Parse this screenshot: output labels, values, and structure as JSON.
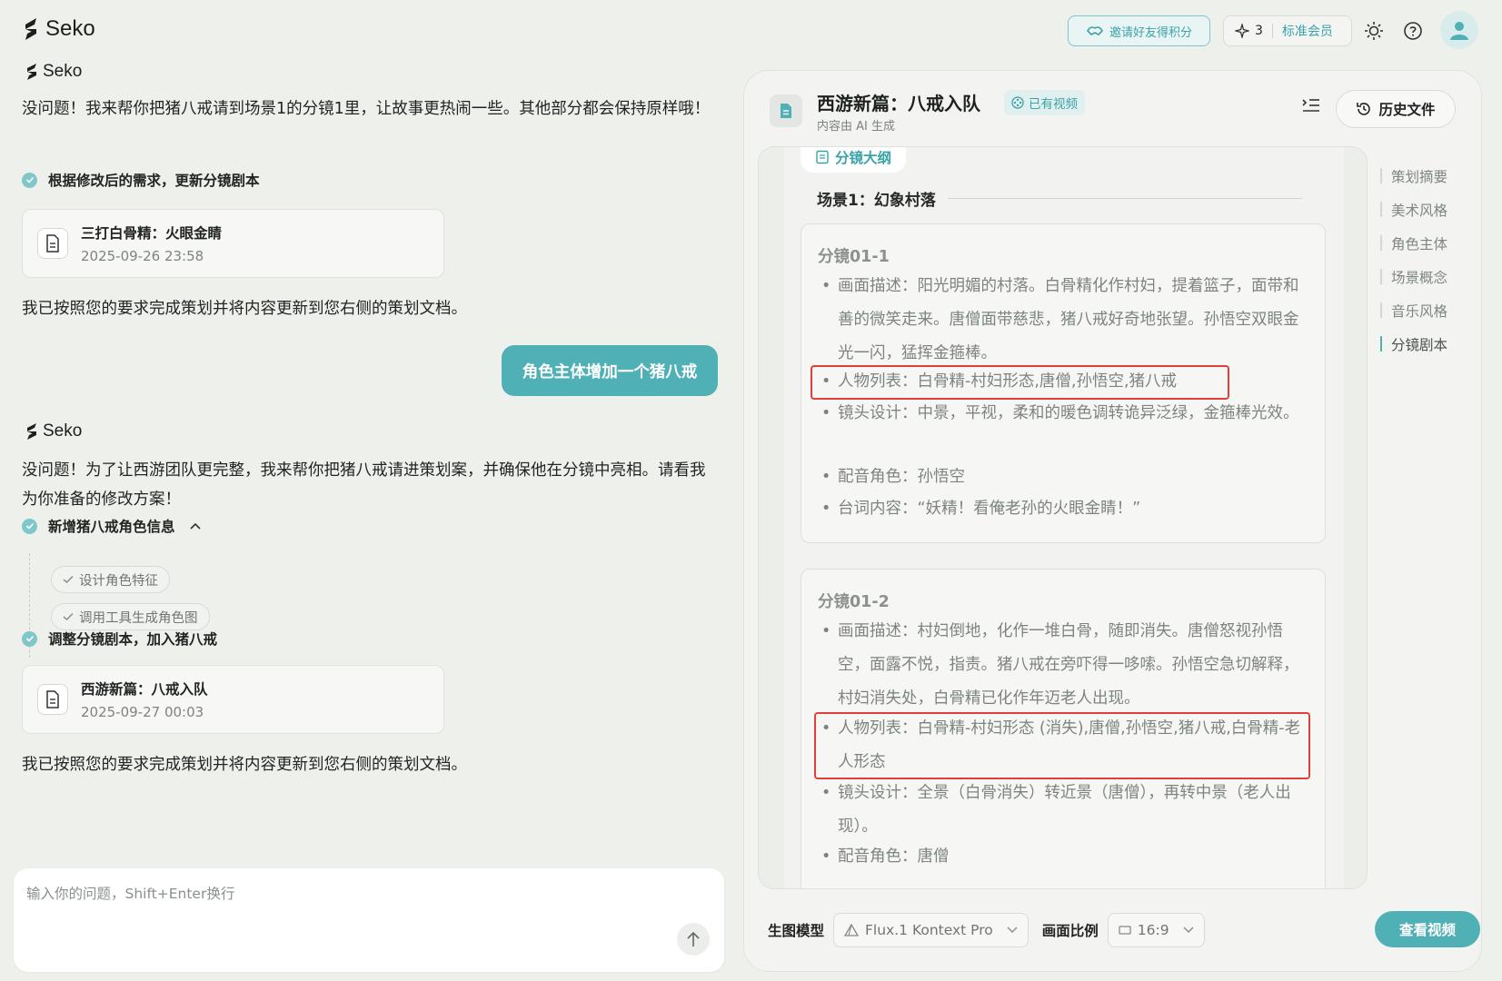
{
  "app": {
    "name": "Seko"
  },
  "topbar": {
    "invite_label": "邀请好友得积分",
    "credits": "3",
    "tier": "标准会员",
    "accent_color": "#4fb0b5"
  },
  "chat": {
    "msg1": {
      "speaker": "Seko",
      "text": "没问题！我来帮你把猪八戒请到场景1的分镜1里，让故事更热闹一些。其他部分都会保持原样哦！",
      "step": "根据修改后的需求，更新分镜剧本",
      "file": {
        "title": "三打白骨精：火眼金睛",
        "date": "2025-09-26 23:58"
      },
      "done": "我已按照您的要求完成策划并将内容更新到您右侧的策划文档。"
    },
    "user_msg": "角色主体增加一个猪八戒",
    "msg2": {
      "speaker": "Seko",
      "text": "没问题！为了让西游团队更完整，我来帮你把猪八戒请进策划案，并确保他在分镜中亮相。请看我为你准备的修改方案！",
      "step1": "新增猪八戒角色信息",
      "substeps": [
        "设计角色特征",
        "调用工具生成角色图"
      ],
      "step2": "调整分镜剧本，加入猪八戒",
      "file": {
        "title": "西游新篇：八戒入队",
        "date": "2025-09-27 00:03"
      },
      "done": "我已按照您的要求完成策划并将内容更新到您右侧的策划文档。"
    },
    "input_placeholder": "输入你的问题，Shift+Enter换行"
  },
  "doc": {
    "title": "西游新篇：八戒入队",
    "badge": "已有视频",
    "subtitle": "内容由 AI 生成",
    "history_label": "历史文件",
    "outline_tag": "分镜大纲",
    "scene_title": "场景1：幻象村落",
    "shots": [
      {
        "id": "分镜01-1",
        "desc": "画面描述：阳光明媚的村落。白骨精化作村妇，提着篮子，面带和善的微笑走来。唐僧面带慈悲，猪八戒好奇地张望。孙悟空双眼金光一闪，猛挥金箍棒。",
        "cast": "人物列表：白骨精-村妇形态,唐僧,孙悟空,猪八戒",
        "camera": "镜头设计：中景，平视，柔和的暖色调转诡异泛绿，金箍棒光效。",
        "voice": "配音角色：孙悟空",
        "line": "台词内容：“妖精！看俺老孙的火眼金睛！”"
      },
      {
        "id": "分镜01-2",
        "desc": "画面描述：村妇倒地，化作一堆白骨，随即消失。唐僧怒视孙悟空，面露不悦，指责。猪八戒在旁吓得一哆嗦。孙悟空急切解释，村妇消失处，白骨精已化作年迈老人出现。",
        "cast": "人物列表：白骨精-村妇形态 (消失),唐僧,孙悟空,猪八戒,白骨精-老人形态",
        "camera": "镜头设计：全景（白骨消失）转近景（唐僧），再转中景（老人出现）。",
        "voice": "配音角色：唐僧"
      }
    ],
    "toc": [
      "策划摘要",
      "美术风格",
      "角色主体",
      "场景概念",
      "音乐风格",
      "分镜剧本"
    ],
    "toc_active": "分镜剧本",
    "footer": {
      "model_label": "生图模型",
      "model_value": "Flux.1 Kontext Pro",
      "ratio_label": "画面比例",
      "ratio_value": "16:9",
      "view_video": "查看视频"
    }
  }
}
